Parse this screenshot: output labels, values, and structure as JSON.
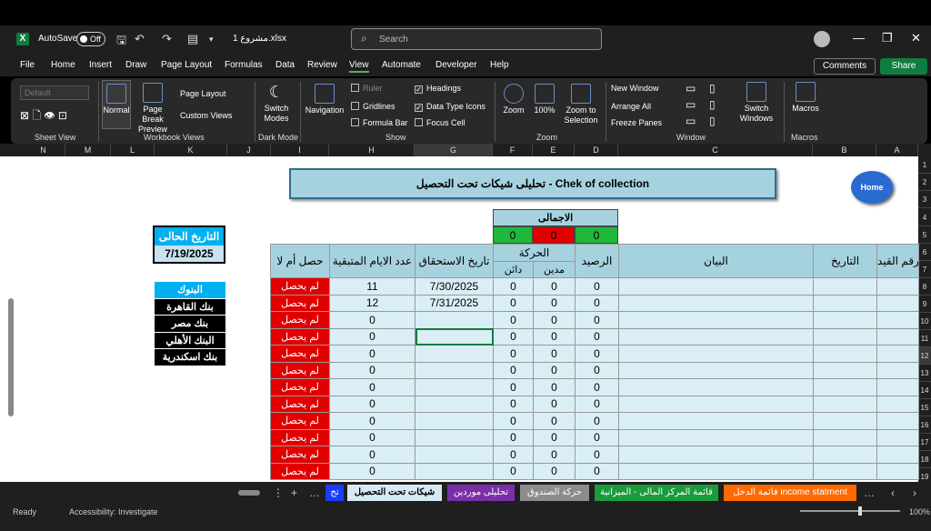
{
  "titlebar": {
    "autosave_label": "AutoSave",
    "autosave_state": "Off",
    "file_name": "مشروع 1.xlsx",
    "search_placeholder": "Search"
  },
  "menu": {
    "items": [
      "File",
      "Home",
      "Insert",
      "Draw",
      "Page Layout",
      "Formulas",
      "Data",
      "Review",
      "View",
      "Automate",
      "Developer",
      "Help"
    ],
    "active": "View",
    "comments": "Comments",
    "share": "Share"
  },
  "ribbon": {
    "sheet_view": {
      "default_label": "Default",
      "group": "Sheet View"
    },
    "workbook_views": {
      "normal": "Normal",
      "page_break": "Page Break Preview",
      "page_layout": "Page Layout",
      "custom_views": "Custom Views",
      "group": "Workbook Views"
    },
    "dark_mode": {
      "switch_modes": "Switch Modes",
      "group": "Dark Mode"
    },
    "show": {
      "navigation": "Navigation",
      "ruler": "Ruler",
      "gridlines": "Gridlines",
      "formula_bar": "Formula Bar",
      "headings": "Headings",
      "data_type_icons": "Data Type Icons",
      "focus_cell": "Focus Cell",
      "group": "Show"
    },
    "zoom": {
      "zoom": "Zoom",
      "hundred": "100%",
      "zoom_selection": "Zoom to Selection",
      "group": "Zoom"
    },
    "window": {
      "new_window": "New Window",
      "arrange_all": "Arrange All",
      "freeze_panes": "Freeze Panes",
      "switch_windows": "Switch Windows",
      "group": "Window"
    },
    "macros": {
      "macros": "Macros",
      "group": "Macros"
    }
  },
  "columns": [
    "N",
    "M",
    "L",
    "K",
    "J",
    "I",
    "H",
    "G",
    "F",
    "E",
    "D",
    "C",
    "B",
    "A"
  ],
  "rows": [
    "1",
    "2",
    "3",
    "4",
    "5",
    "6",
    "7",
    "8",
    "9",
    "10",
    "11",
    "12",
    "13",
    "14",
    "15",
    "16",
    "17",
    "18",
    "19"
  ],
  "sheet": {
    "title": "تحليلى شيكات تحت التحصيل  -  Chek of collection",
    "home": "Home",
    "totals": {
      "label": "الاجمالى",
      "values": [
        "0",
        "0",
        "0"
      ]
    },
    "current_date_label": "التاريخ الحالى",
    "current_date": "7/19/2025",
    "banks": [
      "البنوك",
      "بنك القاهرة",
      "بنك مصر",
      "البنك الأهلي",
      "بنك اسكندرية"
    ],
    "headers": {
      "collected": "حصل أم لا",
      "days_left": "عدد الايام المتبقية",
      "due_date": "تاريخ الاستحقاق",
      "movement": "الحركة",
      "credit": "دائن",
      "debit": "مدين",
      "balance": "الرصيد",
      "description": "البيان",
      "date": "التاريخ",
      "entry_no": "رقم القيد"
    },
    "data_rows": [
      {
        "status": "لم يحصل",
        "days": "11",
        "due": "7/30/2025",
        "credit": "0",
        "debit": "0",
        "balance": "0"
      },
      {
        "status": "لم يحصل",
        "days": "12",
        "due": "7/31/2025",
        "credit": "0",
        "debit": "0",
        "balance": "0"
      },
      {
        "status": "لم يحصل",
        "days": "0",
        "due": "",
        "credit": "0",
        "debit": "0",
        "balance": "0"
      },
      {
        "status": "لم يحصل",
        "days": "0",
        "due": "",
        "credit": "0",
        "debit": "0",
        "balance": "0"
      },
      {
        "status": "لم يحصل",
        "days": "0",
        "due": "",
        "credit": "0",
        "debit": "0",
        "balance": "0"
      },
      {
        "status": "لم يحصل",
        "days": "0",
        "due": "",
        "credit": "0",
        "debit": "0",
        "balance": "0"
      },
      {
        "status": "لم يحصل",
        "days": "0",
        "due": "",
        "credit": "0",
        "debit": "0",
        "balance": "0"
      },
      {
        "status": "لم يحصل",
        "days": "0",
        "due": "",
        "credit": "0",
        "debit": "0",
        "balance": "0"
      },
      {
        "status": "لم يحصل",
        "days": "0",
        "due": "",
        "credit": "0",
        "debit": "0",
        "balance": "0"
      },
      {
        "status": "لم يحصل",
        "days": "0",
        "due": "",
        "credit": "0",
        "debit": "0",
        "balance": "0"
      },
      {
        "status": "لم يحصل",
        "days": "0",
        "due": "",
        "credit": "0",
        "debit": "0",
        "balance": "0"
      },
      {
        "status": "لم يحصل",
        "days": "0",
        "due": "",
        "credit": "0",
        "debit": "0",
        "balance": "0"
      }
    ]
  },
  "sheet_tabs": [
    {
      "label": "قائمة الدخل income statment",
      "color": "#ff6a00"
    },
    {
      "label": "قائمة المركز المالى - الميزانية",
      "color": "#1a9b3c"
    },
    {
      "label": "حركة الصندوق",
      "color": "#8c8c8c"
    },
    {
      "label": "تحليلى موردين",
      "color": "#7a2fa8"
    },
    {
      "label": "شيكات تحت التحصيل",
      "color": "#d6e9f5",
      "active": true
    },
    {
      "label": "تح",
      "color": "#1a3cff"
    }
  ],
  "status": {
    "ready": "Ready",
    "accessibility": "Accessibility: Investigate",
    "zoom": "100%"
  },
  "colors": {
    "accent": "#107c41",
    "header_blue": "#a6d2e0",
    "red": "#e00000"
  }
}
